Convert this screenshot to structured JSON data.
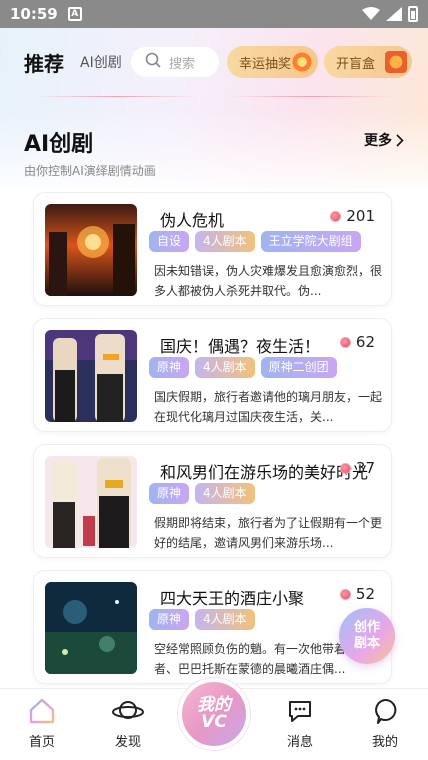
{
  "status_bar": {
    "time": "10:59",
    "notification_glyph": "A"
  },
  "top_nav": {
    "tab_recommend": "推荐",
    "tab_ai": "AI创剧",
    "search_placeholder": "搜索",
    "lucky_draw": "幸运抽奖",
    "blind_box": "开盲盒"
  },
  "section": {
    "title": "AI创剧",
    "more": "更多",
    "subtitle": "由你控制AI演绎剧情动画"
  },
  "cards": [
    {
      "title": "伪人危机",
      "hot": "201",
      "tags": [
        "自设",
        "4人剧本",
        "王立学院大剧组"
      ],
      "desc": "因未知错误，伪人灾难爆发且愈演愈烈，很多人都被伪人杀死并取代。伪..."
    },
    {
      "title": "国庆！偶遇？夜生活！",
      "hot": "62",
      "tags": [
        "原神",
        "4人剧本",
        "原神二创团"
      ],
      "desc": "国庆假期，旅行者邀请他的璃月朋友，一起在现代化璃月过国庆夜生活，关..."
    },
    {
      "title": "和风男们在游乐场的美好时光",
      "hot": "37",
      "tags": [
        "原神",
        "4人剧本"
      ],
      "desc": "假期即将结束，旅行者为了让假期有一个更好的结尾，邀请风男们来游乐场..."
    },
    {
      "title": "四大天王的酒庄小聚",
      "hot": "52",
      "tags": [
        "原神",
        "4人剧本"
      ],
      "desc": "空经常照顾负伤的魈。有一次他带着流浪者、巴巴托斯在蒙德的晨曦酒庄偶..."
    }
  ],
  "fab": {
    "line1": "创作",
    "line2": "剧本"
  },
  "bottom_nav": {
    "home": "首页",
    "discover": "发现",
    "center_line1": "我的",
    "center_line2": "VC",
    "messages": "消息",
    "mine": "我的"
  },
  "colors": {
    "tag_start": "#9fb4f0",
    "tag_end": "#c9a6f2",
    "pill": "#f6c791",
    "hot_drop": "#e8465c"
  }
}
